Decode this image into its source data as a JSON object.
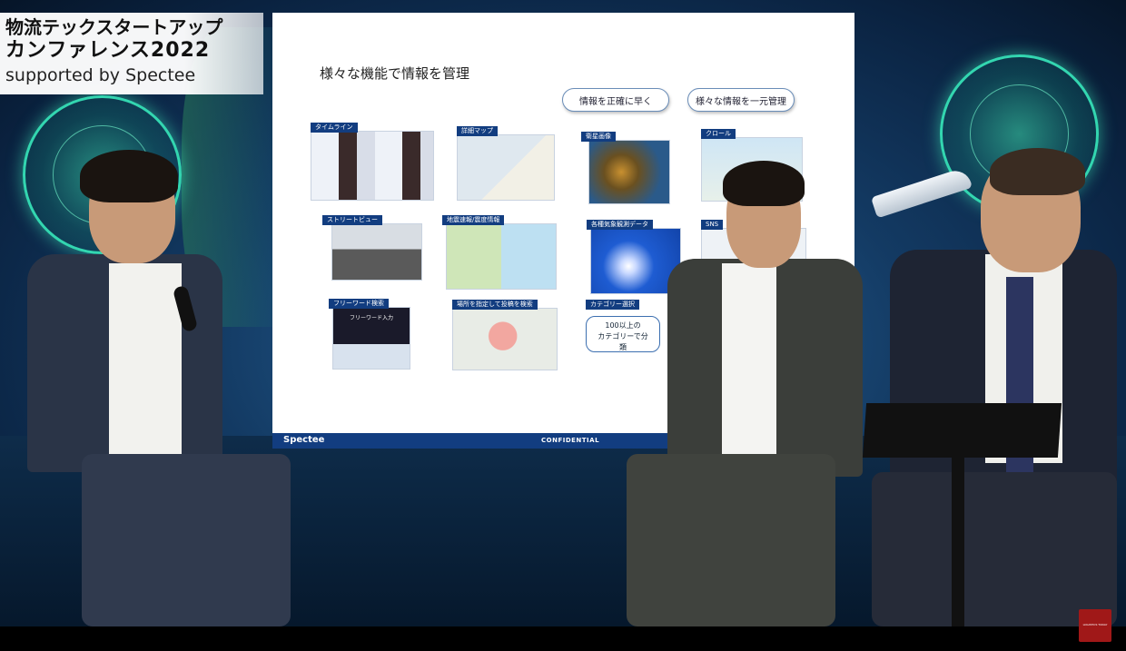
{
  "event_title": {
    "line1": "物流テックスタートアップ",
    "line2": "カンファレンス2022",
    "line3": "supported by Spectee"
  },
  "slide": {
    "heading": "様々な機能で情報を管理",
    "pill_left": "情報を正確に早く",
    "pill_right": "様々な情報を一元管理",
    "features": [
      "タイムライン",
      "詳細マップ",
      "衛星画像",
      "クロール",
      "ストリートビュー",
      "地震速報/震度情報",
      "各種気象観測データ",
      "SNS",
      "フリーワード検索",
      "場所を指定して投稿を検索",
      "カテゴリー選択"
    ],
    "freeword_box": "フリーワード入力",
    "callout": "100以上の\nカテゴリーで分\n類",
    "footer_brand": "Spectee",
    "footer_confidential": "CONFIDENTIAL"
  },
  "colors": {
    "slide_blue": "#123d80",
    "radar_green": "#33d6b0",
    "background_blue": "#133a63"
  },
  "corner_logo": "LOGISTICS TODAY"
}
